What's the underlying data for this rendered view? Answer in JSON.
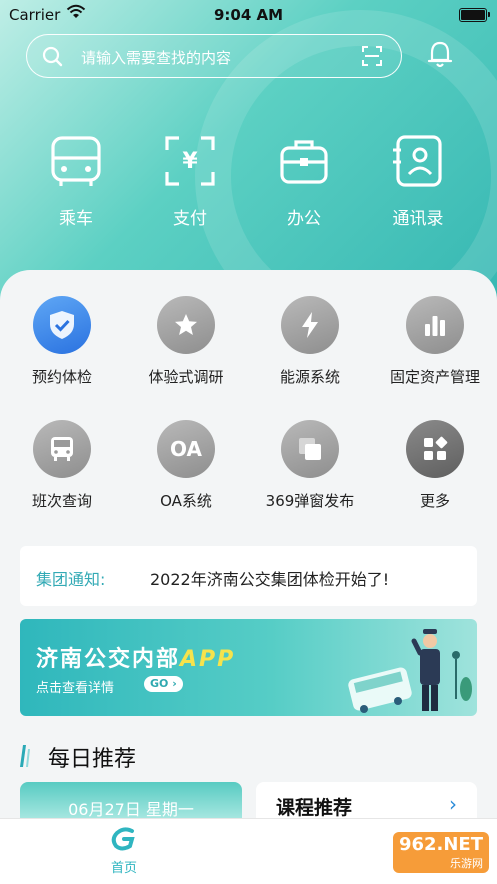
{
  "status": {
    "carrier": "Carrier",
    "time": "9:04 AM"
  },
  "search": {
    "placeholder": "请输入需要查找的内容"
  },
  "quick_actions": [
    "乘车",
    "支付",
    "办公",
    "通讯录"
  ],
  "apps": [
    "预约体检",
    "体验式调研",
    "能源系统",
    "固定资产管理",
    "班次查询",
    "OA系统",
    "369弹窗发布",
    "更多"
  ],
  "oa_icon_text": "OA",
  "notice": {
    "tag": "集团通知:",
    "text": "2022年济南公交集团体检开始了!"
  },
  "banner": {
    "title": "济南公交内部",
    "title_accent": "APP",
    "subtitle": "点击查看详情",
    "go": "GO ›"
  },
  "daily": {
    "title": "每日推荐",
    "date": "06月27日 星期一",
    "course": "课程推荐",
    "course_arrow": "›"
  },
  "tabbar": {
    "home": "首页"
  },
  "watermark": {
    "main": "962.NET",
    "sub": "乐游网"
  },
  "colors": {
    "teal": "#37b8b3",
    "accent_blue": "#2a72e0",
    "notice_tag": "#33aab5"
  }
}
